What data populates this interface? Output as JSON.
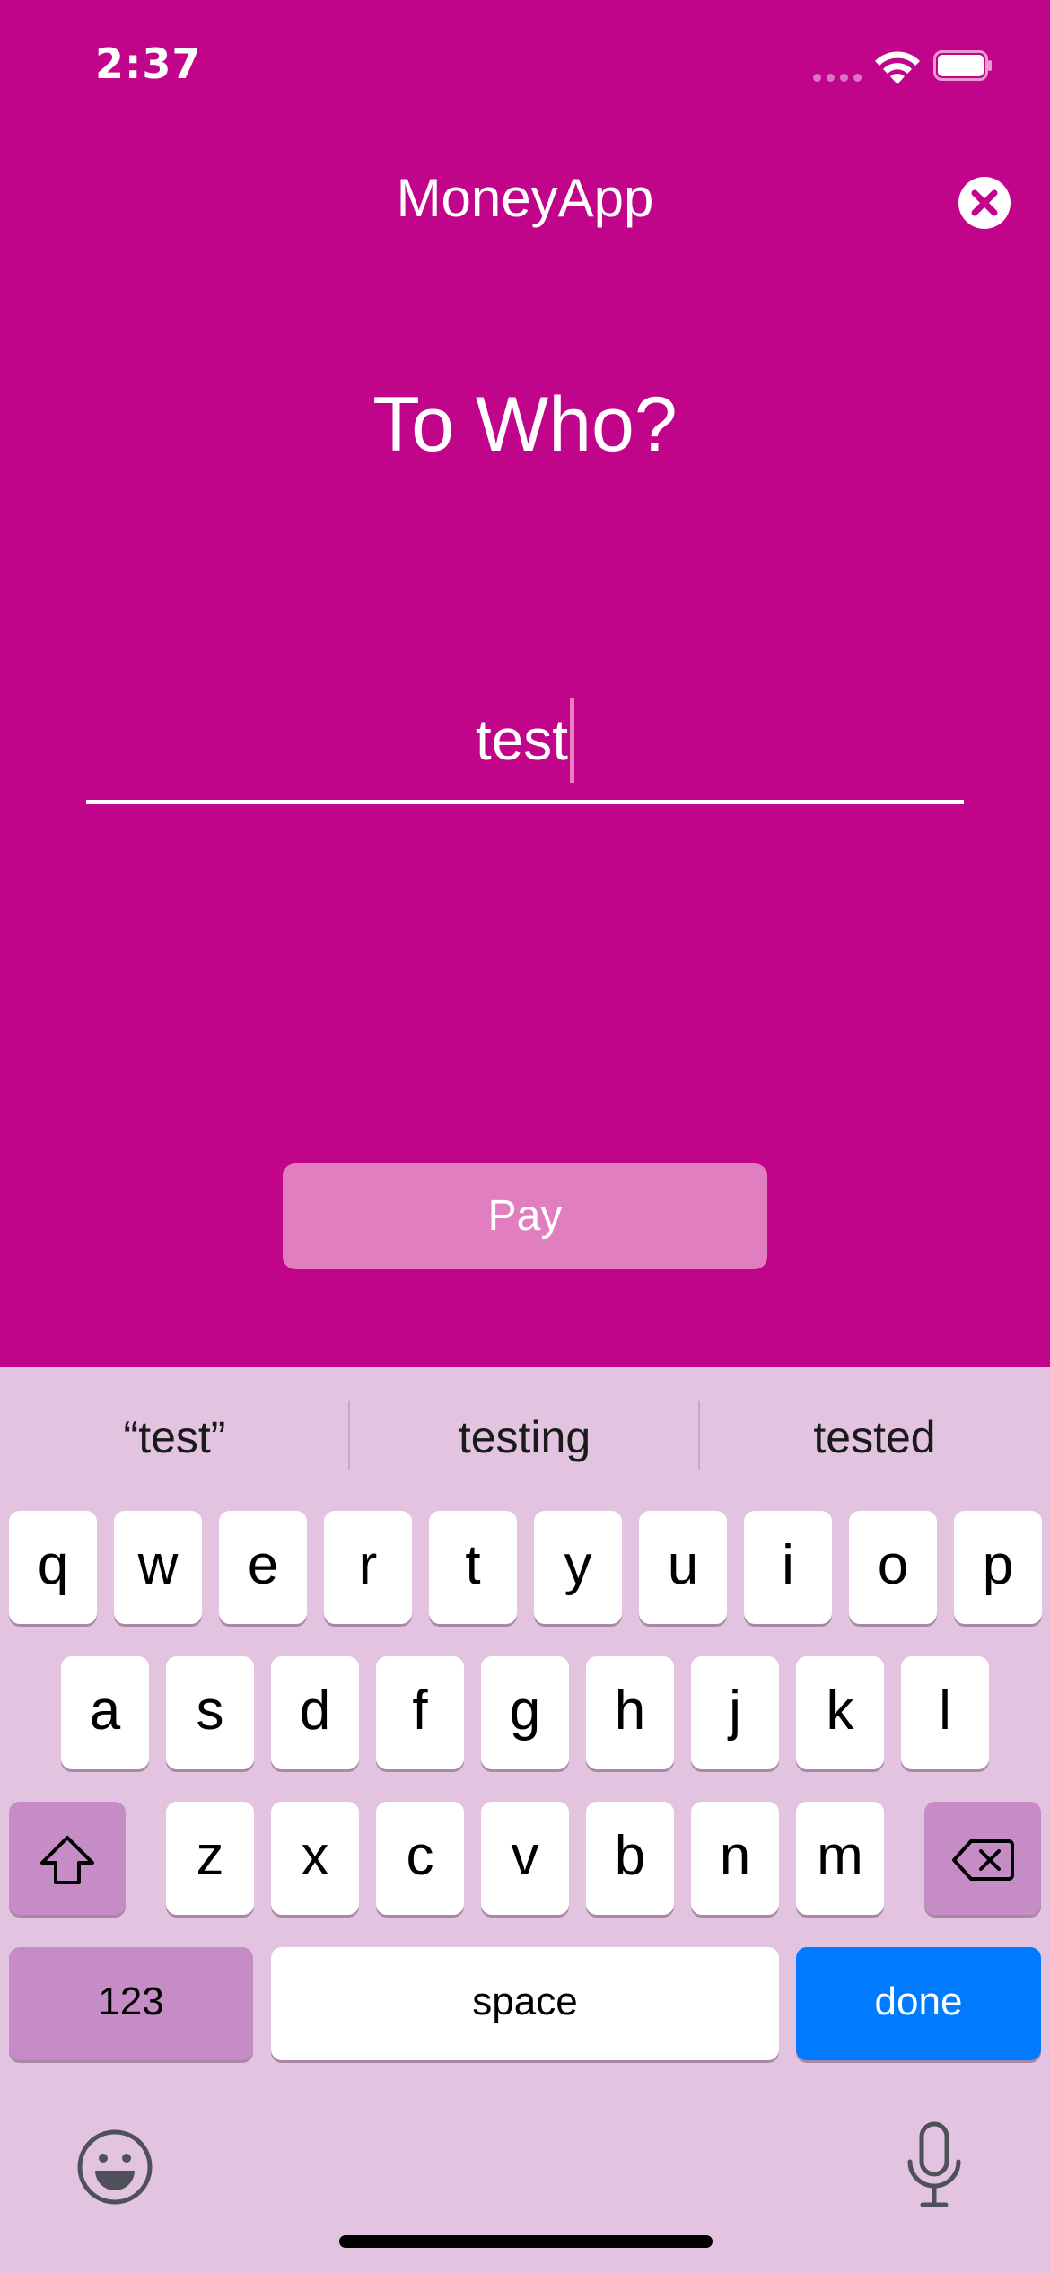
{
  "status_bar": {
    "time": "2:37"
  },
  "header": {
    "title": "MoneyApp",
    "close_icon": "close-circle-icon"
  },
  "main": {
    "heading": "To Who?",
    "recipient_value": "test",
    "pay_label": "Pay"
  },
  "keyboard": {
    "suggestions": [
      "“test”",
      "testing",
      "tested"
    ],
    "row1": [
      "q",
      "w",
      "e",
      "r",
      "t",
      "y",
      "u",
      "i",
      "o",
      "p"
    ],
    "row2": [
      "a",
      "s",
      "d",
      "f",
      "g",
      "h",
      "j",
      "k",
      "l"
    ],
    "row3": [
      "z",
      "x",
      "c",
      "v",
      "b",
      "n",
      "m"
    ],
    "numbers_label": "123",
    "space_label": "space",
    "done_label": "done",
    "shift_icon": "shift-icon",
    "delete_icon": "backspace-icon",
    "emoji_icon": "emoji-icon",
    "mic_icon": "microphone-icon"
  },
  "colors": {
    "background": "#C0058A",
    "keyboard_bg": "#E2C4E0",
    "pay_button": "#E07EC0",
    "done_key": "#007AFF",
    "special_key": "#C68CC5"
  }
}
